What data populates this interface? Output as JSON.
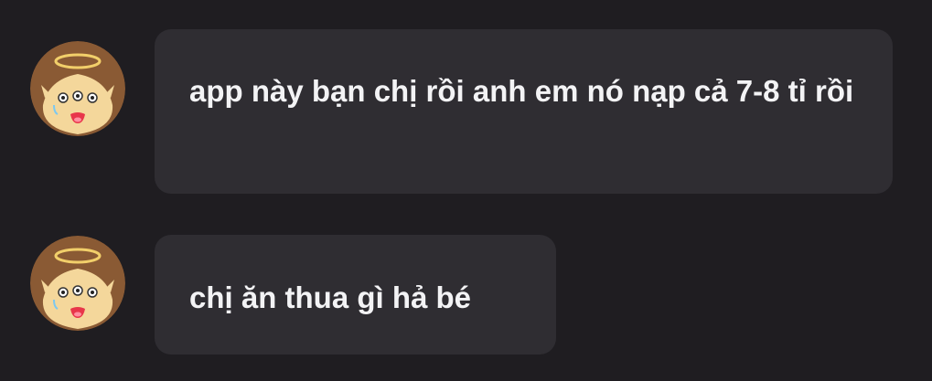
{
  "messages": [
    {
      "sender_avatar": "angel-potato-avatar",
      "text": "app này bạn chị rồi anh em nó nạp cả 7-8 tỉ rồi"
    },
    {
      "sender_avatar": "angel-potato-avatar",
      "text": "chị ăn thua gì hả bé"
    }
  ],
  "colors": {
    "background": "#1f1d21",
    "bubble": "#2f2d32",
    "text": "#f3f3f5",
    "avatar_background": "#8a5a34",
    "face": "#f4d79b"
  }
}
